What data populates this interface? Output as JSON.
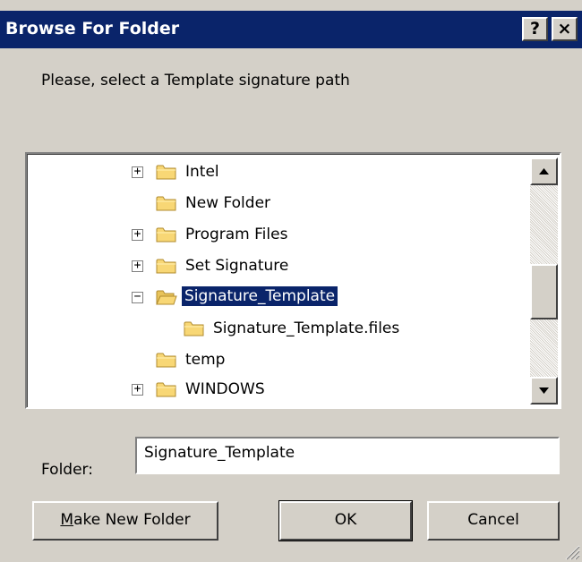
{
  "window": {
    "title": "Browse For Folder",
    "help_glyph": "?",
    "close_glyph": "×"
  },
  "prompt": "Please, select a Template signature path",
  "tree": {
    "items": [
      {
        "label": "Intel",
        "expander": "+",
        "selected": false
      },
      {
        "label": "New Folder",
        "expander": "",
        "selected": false
      },
      {
        "label": "Program Files",
        "expander": "+",
        "selected": false
      },
      {
        "label": "Set Signature",
        "expander": "+",
        "selected": false
      },
      {
        "label": "Signature_Template",
        "expander": "−",
        "selected": true
      },
      {
        "label": "Signature_Template.files",
        "expander": "",
        "selected": false
      },
      {
        "label": "temp",
        "expander": "",
        "selected": false
      },
      {
        "label": "WINDOWS",
        "expander": "+",
        "selected": false
      }
    ]
  },
  "folder_field": {
    "label": "Folder:",
    "value": "Signature_Template"
  },
  "buttons": {
    "make_new_folder_prefix": "M",
    "make_new_folder_rest": "ake New Folder",
    "ok": "OK",
    "cancel": "Cancel"
  },
  "colors": {
    "title_bar": "#0a246a",
    "dialog_face": "#d4d0c8",
    "folder_yellow": "#f8d775",
    "selection": "#0a246a"
  },
  "icons": {
    "folder": "folder-icon",
    "scroll_up": "arrow-up-icon",
    "scroll_down": "arrow-down-icon",
    "resize_grip": "resize-grip-icon"
  }
}
